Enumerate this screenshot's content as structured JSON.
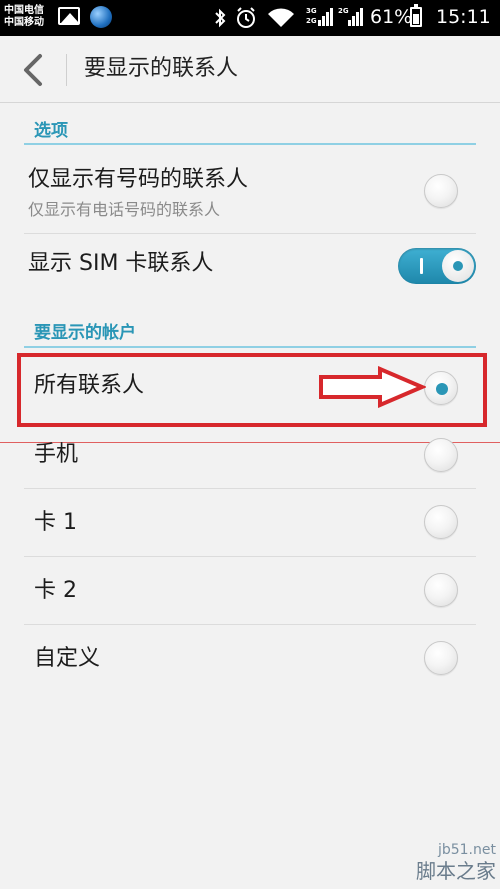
{
  "status_bar": {
    "carrier_1": "中国电信",
    "carrier_2": "中国移动",
    "net_1": "3G",
    "net_2": "2G",
    "net_3": "2G",
    "battery": "61%",
    "time": "15:11",
    "icons": [
      "gallery-icon",
      "globe-icon",
      "bluetooth-icon",
      "alarm-icon",
      "wifi-icon",
      "signal-icon",
      "battery-icon"
    ]
  },
  "header": {
    "title": "要显示的联系人",
    "back_icon": "chevron-left-icon"
  },
  "sections": {
    "options_header": "选项",
    "accounts_header": "要显示的帐户"
  },
  "options": [
    {
      "title": "仅显示有号码的联系人",
      "subtitle": "仅显示有电话号码的联系人",
      "checked": false
    },
    {
      "title": "显示 SIM 卡联系人",
      "toggle_on": true
    }
  ],
  "accounts": [
    {
      "label": "所有联系人",
      "checked": true
    },
    {
      "label": "手机",
      "checked": false
    },
    {
      "label": "卡 1",
      "checked": false
    },
    {
      "label": "卡 2",
      "checked": false
    },
    {
      "label": "自定义",
      "checked": false
    }
  ],
  "annotation": {
    "box_color": "#d7282c",
    "arrow_color": "#d7282c"
  },
  "watermark": {
    "url": "jb51.net",
    "text": "脚本之家"
  },
  "colors": {
    "accent": "#2a96b6",
    "background": "#f2f2f2"
  }
}
